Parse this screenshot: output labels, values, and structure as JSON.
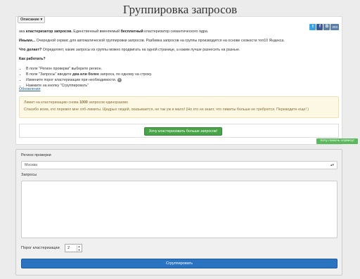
{
  "page": {
    "title": "Группировка запросов"
  },
  "description": {
    "toggle_label": "Описание",
    "toggle_caret": "▾",
    "line1_pre": "ака ",
    "line1_b1": "кластеризатор запросов.",
    "line1_mid": " Единственный вменяемый ",
    "line1_b2": "бесплатный",
    "line1_post": " кластеризатор семантического ядра.",
    "line2_b": "Иными...",
    "line2_text": " Очередной сервис для автоматической группировки запросов. Разбивка запросов на группы производится на основе схожести топ10 Яндекса.",
    "line3_b": "Что делает?",
    "line3_text": " Определяет, какие запросы из группы можно продвигать на одной странице, а каким лучше разнесить на разные.",
    "how_title": "Как работать?",
    "steps": [
      "В поле \"Регион проверки\" выберите регион.",
      "В поле \"Запросы\" вводите ",
      "Измените порог кластеризации при необходимости.",
      "Нажмите на кнопку \"Сгруппировать\""
    ],
    "step2_bold": "два или более",
    "step2_post": " запроса, по одному на строку.",
    "help_icon": "?",
    "updates_link": "Обновления"
  },
  "social": {
    "twitter_icon": "t",
    "facebook_icon": "f",
    "vk_icon": "B",
    "vk_count": "203"
  },
  "alert": {
    "line1_pre": "Лимит на кластеризацию снова ",
    "line1_b": "1000",
    "line1_post": " запросов единоразово",
    "line2": "Спасибо всем, кто перевел мне хлб-лимиты. Щедрых людей, оказывается, не так уж и мало! (Но кто не знает, что лимиты больше не требуются. Переводите еще! )"
  },
  "promo": {
    "green_button": "Хочу кластеризовать больше запросов!"
  },
  "corner_button": "Хочу помочь сервису!",
  "form": {
    "region_label": "Регион проверки",
    "region_value": "Москва",
    "region_caret": "▴▾",
    "queries_label": "Запросы",
    "queries_value": "",
    "threshold_label": "Порог кластеризации",
    "threshold_value": "2",
    "stepper_up": "▲",
    "stepper_down": "▼",
    "submit_label": "Сгруппировать"
  },
  "colors": {
    "green": "#47a447",
    "blue": "#2a73c0",
    "alert_bg": "#fcf8e3"
  }
}
